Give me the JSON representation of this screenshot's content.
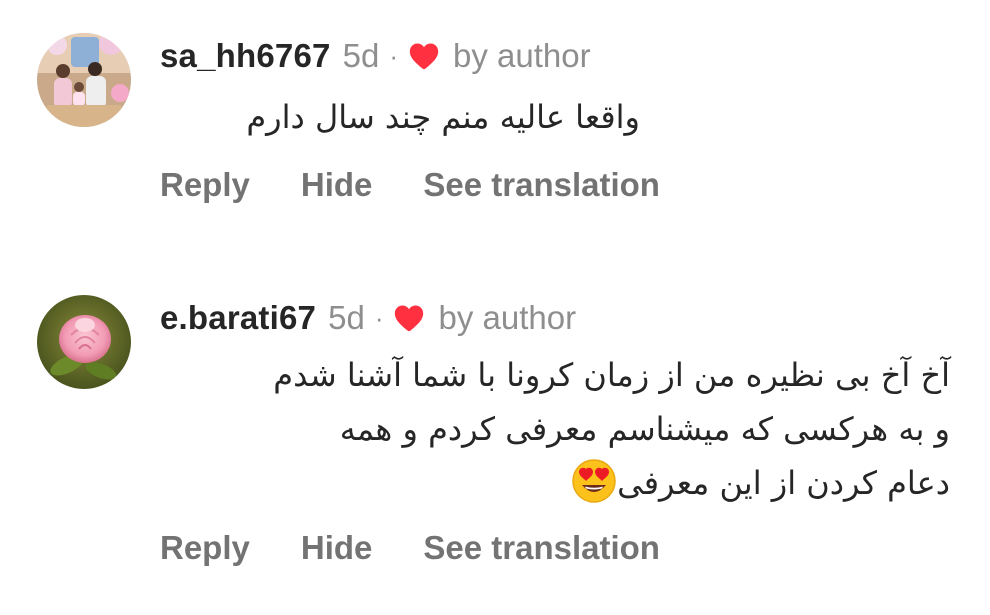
{
  "comments": [
    {
      "username": "sa_hh6767",
      "time": "5d",
      "separator": "·",
      "by_author": "by author",
      "text_lines": [
        "واقعا عالیه منم چند سال دارم"
      ],
      "actions": {
        "reply": "Reply",
        "hide": "Hide",
        "translate": "See translation"
      },
      "avatar": "family-photo-avatar"
    },
    {
      "username": "e.barati67",
      "time": "5d",
      "separator": "·",
      "by_author": "by author",
      "text_lines": [
        "آخ آخ بی نظیره من از زمان کرونا با شما آشنا شدم",
        "و به هرکسی که میشناسم معرفی کردم و همه",
        "دعام کردن از این معرفی"
      ],
      "emoji": "heart-eyes-emoji",
      "actions": {
        "reply": "Reply",
        "hide": "Hide",
        "translate": "See translation"
      },
      "avatar": "pink-rose-avatar"
    }
  ],
  "colors": {
    "heart": "#ff3040",
    "username": "#262626",
    "secondary": "#8e8e8e",
    "action": "#737373"
  },
  "icons": {
    "liked_by_author": "heart-icon"
  }
}
